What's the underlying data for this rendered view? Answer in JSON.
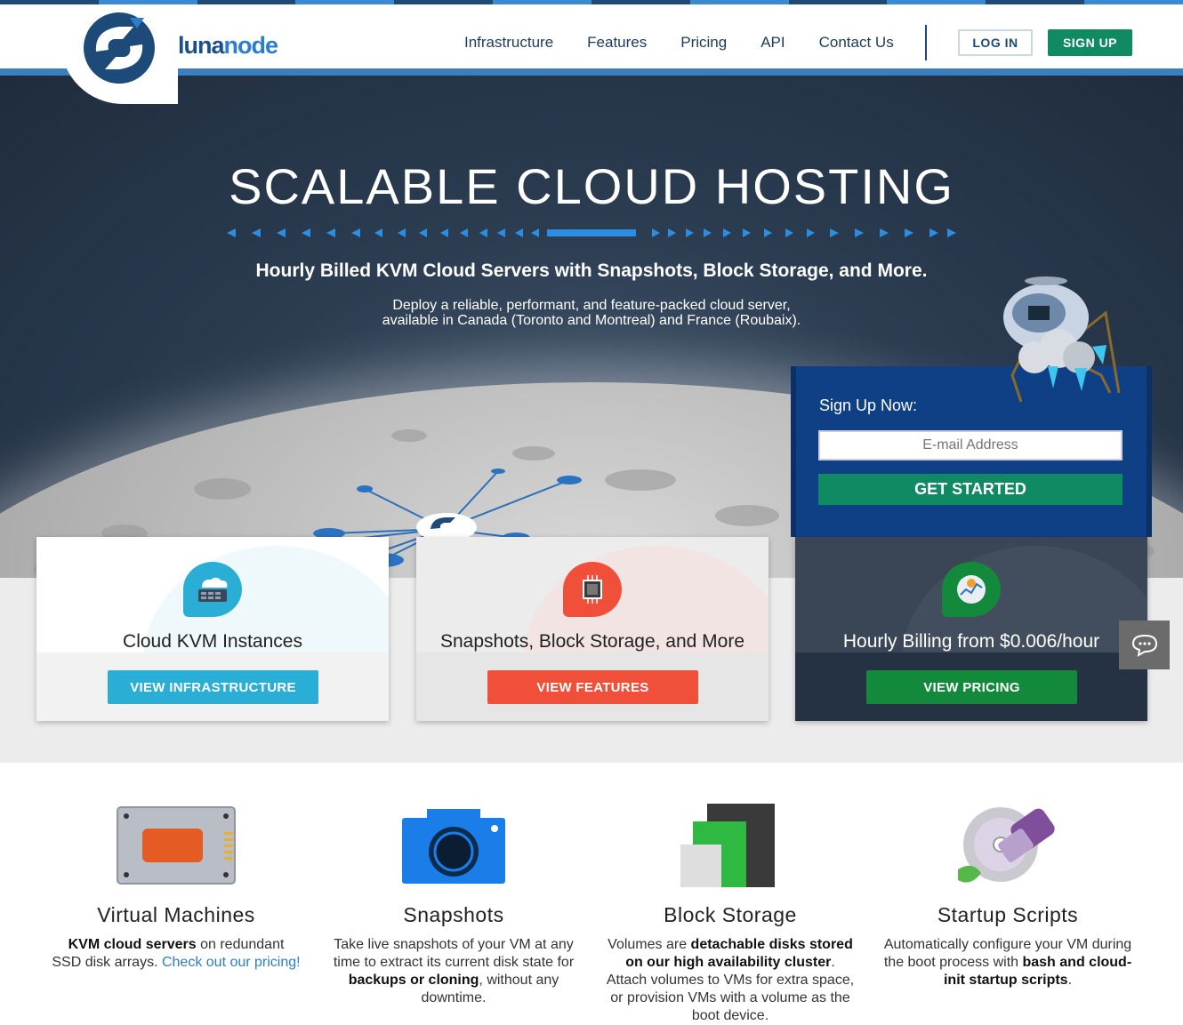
{
  "brand": {
    "name_part1": "luna",
    "name_part2": "node"
  },
  "nav": {
    "items": [
      "Infrastructure",
      "Features",
      "Pricing",
      "API",
      "Contact Us"
    ],
    "login_label": "LOG IN",
    "signup_label": "SIGN UP"
  },
  "hero": {
    "title": "SCALABLE CLOUD HOSTING",
    "subtitle": "Hourly Billed KVM Cloud Servers with Snapshots, Block Storage, and More.",
    "desc_line1": "Deploy a reliable, performant, and feature-packed cloud server,",
    "desc_line2": "available in Canada (Toronto and Montreal) and France (Roubaix)."
  },
  "signup_box": {
    "title": "Sign Up Now:",
    "email_placeholder": "E-mail Address",
    "button_label": "GET STARTED"
  },
  "cards": [
    {
      "label": "Cloud KVM Instances",
      "button": "VIEW INFRASTRUCTURE",
      "color": "#2aaed6",
      "icon": "cloud-server-icon"
    },
    {
      "label": "Snapshots, Block Storage, and More",
      "button": "VIEW FEATURES",
      "color": "#f0503a",
      "icon": "cpu-chip-icon"
    },
    {
      "label": "Hourly Billing from $0.006/hour",
      "button": "VIEW PRICING",
      "color": "#138a3b",
      "icon": "billing-chart-icon"
    }
  ],
  "features": [
    {
      "title": "Virtual Machines",
      "text_bold1": "KVM cloud servers",
      "text_plain1": " on redundant SSD disk arrays. ",
      "link": "Check out our pricing!"
    },
    {
      "title": "Snapshots",
      "text_plain1": "Take live snapshots of your VM at any time to extract its current disk state for ",
      "text_bold1": "backups or cloning",
      "text_plain2": ", without any downtime."
    },
    {
      "title": "Block Storage",
      "text_plain1": "Volumes are ",
      "text_bold1": "detachable disks stored on our high availability cluster",
      "text_plain2": ". Attach volumes to VMs for extra space, or provision VMs with a volume as the boot device."
    },
    {
      "title": "Startup Scripts",
      "text_plain1": "Automatically configure your VM during the boot process with ",
      "text_bold1": "bash and cloud-init startup scripts",
      "text_plain2": "."
    }
  ],
  "colors": {
    "brand_blue": "#1d4a79",
    "accent_green": "#0f8a62",
    "signup_panel": "#0f3f85"
  }
}
